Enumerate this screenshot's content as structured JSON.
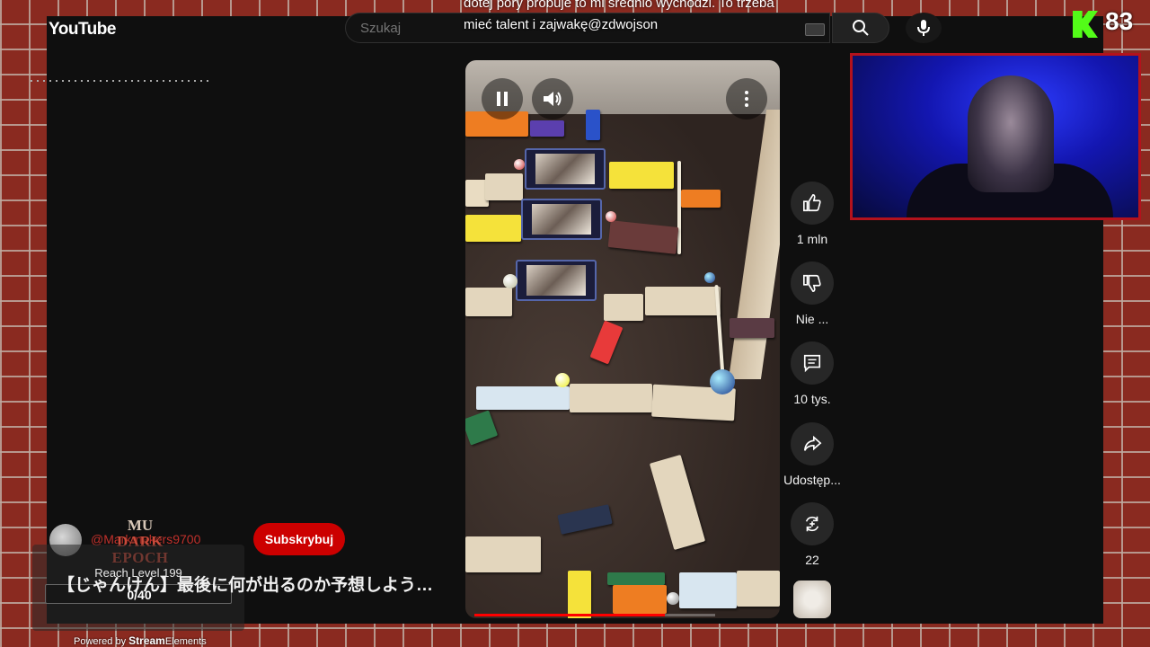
{
  "header": {
    "logo_text": "YouTube",
    "search_placeholder": "Szukaj"
  },
  "overlay_comment": "dotej pory probuje to mi srednio wychodzi. To trzeba mieć talent i zajwakę@zdwojson",
  "video": {
    "progress_fraction": 0.79
  },
  "actions": {
    "like_count": "1 mln",
    "dislike_label": "Nie ...",
    "comments_count": "10 tys.",
    "share_label": "Udostęp...",
    "remix_count": "22"
  },
  "channel": {
    "name": "@Markmakers9700",
    "subscribe_label": "Subskrybuj",
    "video_title": "【じゃんけん】最後に何が出るのか予想しよう…"
  },
  "game_logo": {
    "line1": "MU",
    "line2": "DARK EPOCH"
  },
  "goal_widget": {
    "label": "Reach Level 199",
    "progress": "0/40"
  },
  "powered_by": {
    "prefix": "Powered by",
    "brand_bold": "Stream",
    "brand_rest": "Elements"
  },
  "kick": {
    "viewer_count": "83"
  },
  "colors": {
    "accent_red": "#cc0000",
    "kick_green": "#53fc18",
    "webcam_border": "#b3121c"
  }
}
